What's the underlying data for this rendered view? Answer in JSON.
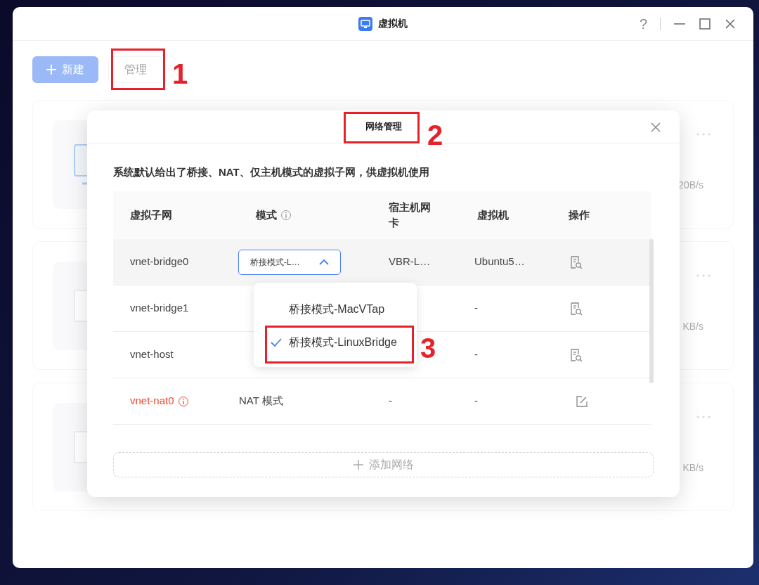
{
  "window": {
    "title": "虚拟机",
    "help": "?"
  },
  "toolbar": [
    {
      "label": "新建",
      "kind": "primary"
    },
    {
      "label": "管理",
      "kind": "plain"
    }
  ],
  "background_cards": [
    {
      "speed": "20B/s",
      "kind": "monitor"
    },
    {
      "speed": "KB/s",
      "kind": "blank"
    },
    {
      "speed": "KB/s",
      "kind": "blank"
    }
  ],
  "dialog": {
    "title": "网络管理",
    "description": "系统默认给出了桥接、NAT、仅主机模式的虚拟子网，供虚拟机使用",
    "columns": [
      {
        "label": "虚拟子网"
      },
      {
        "label": "模式",
        "info": true
      },
      {
        "label": "宿主机网卡"
      },
      {
        "label": "虚拟机"
      },
      {
        "label": "操作"
      }
    ],
    "rows": [
      {
        "subnet": "vnet-bridge0",
        "warning": false,
        "hovered": true,
        "mode": {
          "kind": "select",
          "value": "桥接模式-L…",
          "expanded": true
        },
        "host_nic": "VBR-L…",
        "vm": "Ubuntu5…",
        "action": {
          "kind": "view"
        }
      },
      {
        "subnet": "vnet-bridge1",
        "warning": false,
        "hovered": false,
        "vm": "-",
        "action": {
          "kind": "view"
        }
      },
      {
        "subnet": "vnet-host",
        "warning": false,
        "hovered": false,
        "vm": "-",
        "action": {
          "kind": "view"
        }
      },
      {
        "subnet": "vnet-nat0",
        "warning": true,
        "hovered": false,
        "mode": {
          "kind": "text",
          "value": "NAT 模式"
        },
        "host_nic": "-",
        "vm": "-",
        "action": {
          "kind": "edit"
        }
      }
    ],
    "dropdown": {
      "options": [
        {
          "label": "桥接模式-MacVTap",
          "selected": false
        },
        {
          "label": "桥接模式-LinuxBridge",
          "selected": true
        }
      ]
    },
    "add_button": "添加网络"
  },
  "annotations": [
    {
      "label": "1"
    },
    {
      "label": "2"
    },
    {
      "label": "3"
    }
  ]
}
